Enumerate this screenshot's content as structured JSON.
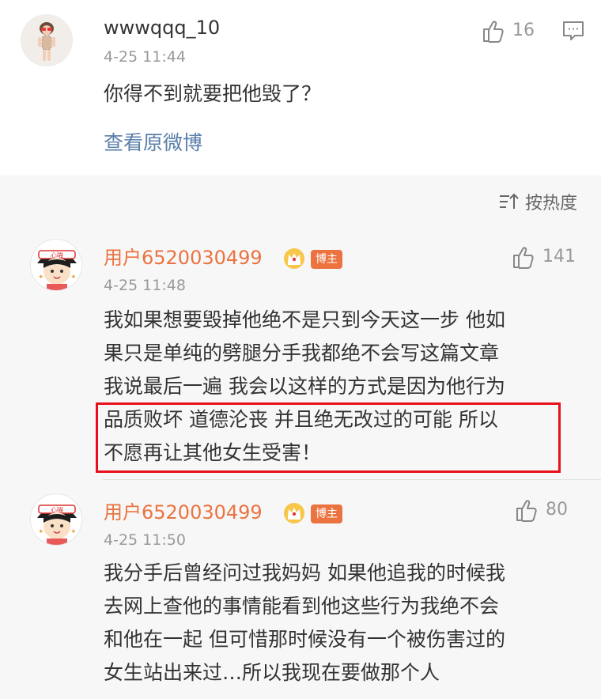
{
  "top_comment": {
    "username": "wwwqqq_10",
    "time": "4-25 11:44",
    "text": "你得不到就要把他毁了？",
    "like_count": "16",
    "view_original": "查看原微博"
  },
  "sort": {
    "label": "按热度"
  },
  "replies": [
    {
      "username": "用户6520030499",
      "badge": "博主",
      "time": "4-25 11:48",
      "like_count": "141",
      "lines": [
        "我如果想要毁掉他绝不是只到今天这一步 他如",
        "果只是单纯的劈腿分手我都绝不会写这篇文章",
        "我说最后一遍 我会以这样的方式是因为他行为",
        "品质败坏 道德沦丧 并且绝无改过的可能 所以",
        "不愿再让其他女生受害！"
      ]
    },
    {
      "username": "用户6520030499",
      "badge": "博主",
      "time": "4-25 11:50",
      "like_count": "80",
      "lines": [
        "我分手后曾经问过我妈妈 如果他追我的时候我",
        "去网上查他的事情能看到他这些行为我绝不会",
        "和他在一起 但可惜那时候没有一个被伤害过的",
        "女生站出来过…所以我现在要做那个人"
      ]
    }
  ],
  "colors": {
    "accent_name": "#eb7340",
    "link": "#5a7ea8",
    "highlight": "#e8101b"
  }
}
